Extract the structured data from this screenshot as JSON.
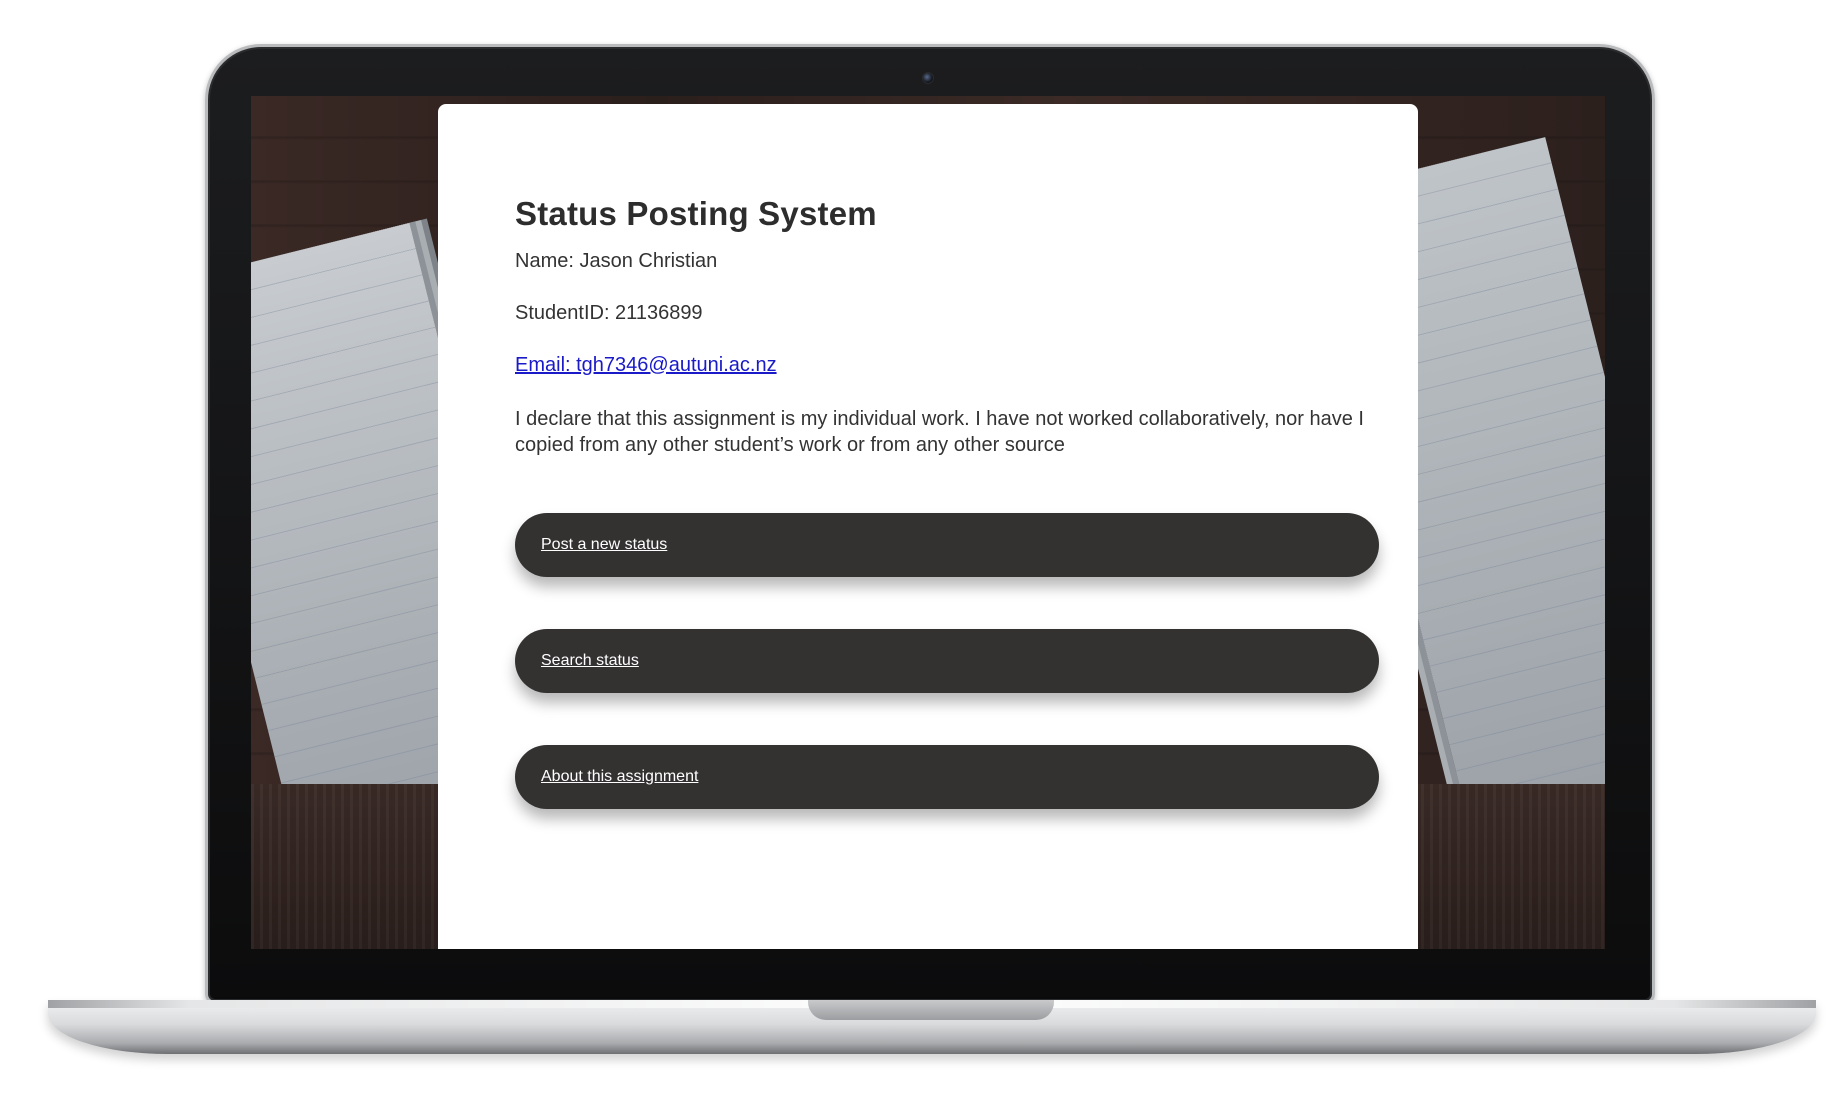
{
  "page": {
    "title": "Status Posting System",
    "name_line": "Name: Jason Christian",
    "student_id_line": "StudentID: 21136899",
    "email_link": "Email: tgh7346@autuni.ac.nz",
    "declaration": "I declare that this assignment is my individual work. I have not worked collaboratively, nor have I copied from any other student’s work or from any other source"
  },
  "nav": {
    "post_label": "Post a new status",
    "search_label": "Search status",
    "about_label": "About this assignment"
  },
  "colors": {
    "button_bg": "#343131",
    "link": "#1a1ac8",
    "text": "#333333"
  }
}
